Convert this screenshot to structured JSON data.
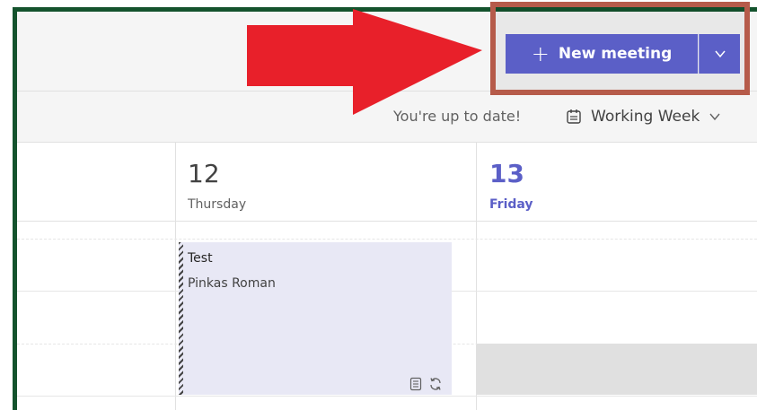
{
  "header": {
    "new_meeting_label": "New meeting"
  },
  "toolbar": {
    "status": "You're up to date!",
    "view_label": "Working Week"
  },
  "days": [
    {
      "number": "12",
      "name": "Thursday"
    },
    {
      "number": "13",
      "name": "Friday"
    }
  ],
  "event": {
    "title": "Test",
    "organizer": "Pinkas Roman"
  },
  "colors": {
    "accent": "#5b5fc7",
    "annotation_arrow": "#e8202a",
    "annotation_box": "#b65b4a",
    "frame": "#14532d"
  },
  "icons": {
    "plus": "plus-icon",
    "chevron": "chevron-down-icon",
    "calendar": "calendar-icon",
    "notes": "notes-icon",
    "recurring": "recurring-icon",
    "arrow": "red-arrow-annotation"
  }
}
